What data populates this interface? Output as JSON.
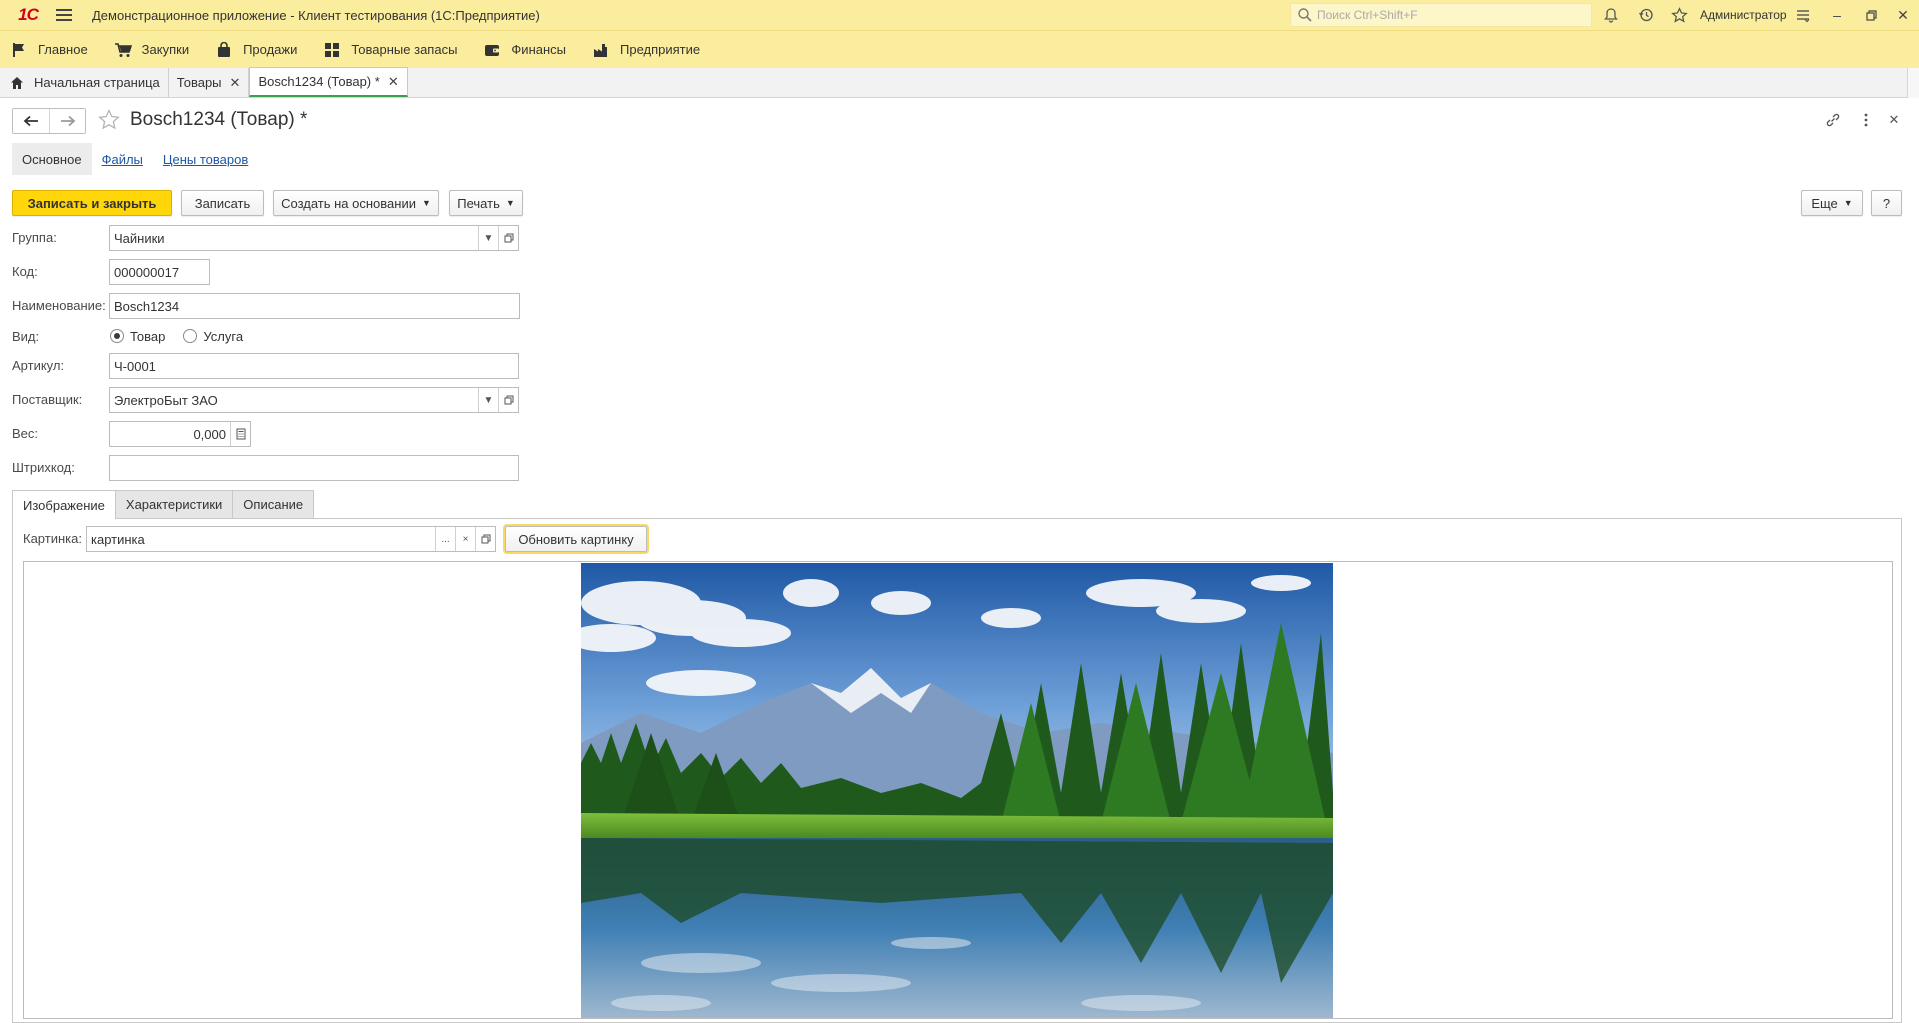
{
  "titlebar": {
    "logo": "1С",
    "title": "Демонстрационное приложение  - Клиент тестирования (1С:Предприятие)",
    "search_placeholder": "Поиск Ctrl+Shift+F",
    "user": "Администратор"
  },
  "sections": [
    {
      "label": "Главное",
      "icon": "flag-icon"
    },
    {
      "label": "Закупки",
      "icon": "cart-icon"
    },
    {
      "label": "Продажи",
      "icon": "bag-icon"
    },
    {
      "label": "Товарные запасы",
      "icon": "grid-icon"
    },
    {
      "label": "Финансы",
      "icon": "wallet-icon"
    },
    {
      "label": "Предприятие",
      "icon": "factory-icon"
    }
  ],
  "open_tabs": [
    {
      "label": "Начальная страница"
    },
    {
      "label": "Товары"
    },
    {
      "label": "Bosch1234 (Товар) *"
    }
  ],
  "form": {
    "title": "Bosch1234 (Товар) *",
    "tabs": [
      "Основное",
      "Файлы",
      "Цены товаров"
    ],
    "commands": {
      "save_close": "Записать и закрыть",
      "save": "Записать",
      "create_based": "Создать на основании",
      "print": "Печать",
      "more": "Еще",
      "help": "?"
    },
    "fields": {
      "group_label": "Группа:",
      "group_value": "Чайники",
      "code_label": "Код:",
      "code_value": "000000017",
      "name_label": "Наименование:",
      "name_value": "Bosch1234",
      "kind_label": "Вид:",
      "kind_options": [
        "Товар",
        "Услуга"
      ],
      "kind_selected": "Товар",
      "article_label": "Артикул:",
      "article_value": "Ч-0001",
      "supplier_label": "Поставщик:",
      "supplier_value": "ЭлектроБыт ЗАО",
      "weight_label": "Вес:",
      "weight_value": "0,000",
      "barcode_label": "Штрихкод:",
      "barcode_value": ""
    },
    "inner_tabs": [
      "Изображение",
      "Характеристики",
      "Описание"
    ],
    "picture": {
      "label": "Картинка:",
      "value": "картинка",
      "refresh_button": "Обновить картинку",
      "select_btn": "...",
      "clear_btn": "×"
    }
  },
  "colors": {
    "titlebar": "#fbed9e",
    "primary_button": "#ffd60a",
    "link": "#1b57a6",
    "active_tab_underline": "#3aa04b"
  }
}
